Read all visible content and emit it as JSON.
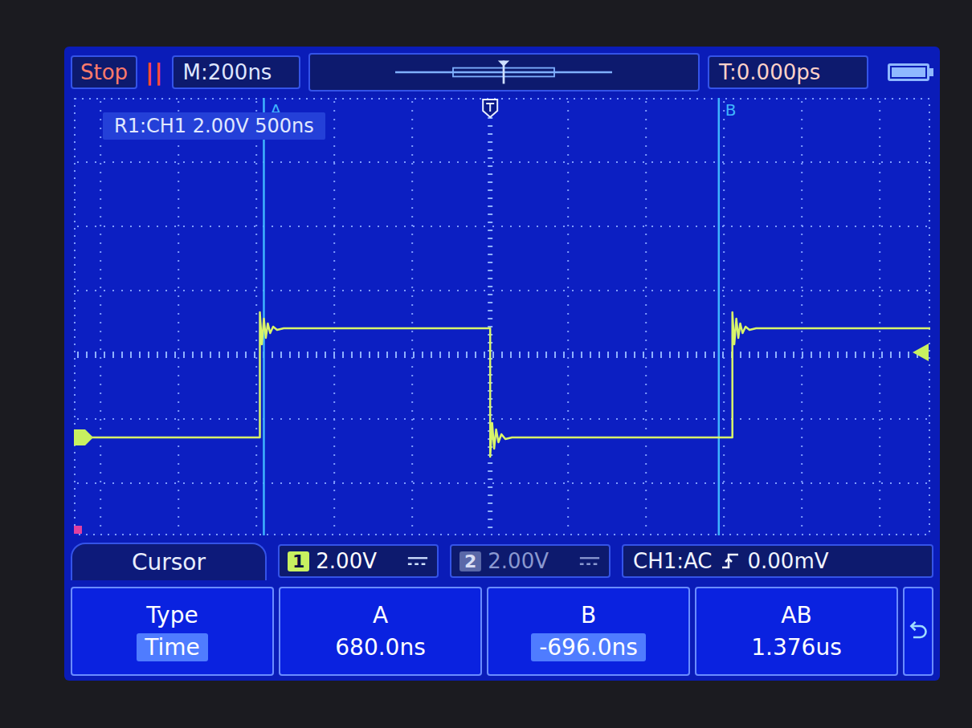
{
  "top_bar": {
    "run_state": "Stop",
    "pause_mark": "||",
    "timebase": "M:200ns",
    "trigger_offset": "T:0.000ps",
    "battery": {
      "level": 1.0
    }
  },
  "plot": {
    "reference_label": "R1:CH1 2.00V 500ns",
    "axis": {
      "time_min_ns": -1260,
      "time_max_ns": 1332
    },
    "waveform": {
      "channel": "CH1",
      "color": "#d8f46a",
      "points": [
        [
          -1260,
          0
        ],
        [
          -697,
          0
        ],
        [
          -697,
          3.9
        ],
        [
          -691,
          2.9
        ],
        [
          -685,
          3.7
        ],
        [
          -679,
          3.1
        ],
        [
          -673,
          3.55
        ],
        [
          -666,
          3.25
        ],
        [
          -657,
          3.45
        ],
        [
          -645,
          3.35
        ],
        [
          -625,
          3.4
        ],
        [
          0,
          3.4
        ],
        [
          0,
          -0.6
        ],
        [
          6,
          0.45
        ],
        [
          12,
          -0.35
        ],
        [
          18,
          0.25
        ],
        [
          25,
          -0.15
        ],
        [
          34,
          0.1
        ],
        [
          46,
          -0.05
        ],
        [
          66,
          0
        ],
        [
          733,
          0
        ],
        [
          733,
          3.9
        ],
        [
          739,
          2.9
        ],
        [
          745,
          3.7
        ],
        [
          751,
          3.1
        ],
        [
          757,
          3.55
        ],
        [
          764,
          3.25
        ],
        [
          773,
          3.45
        ],
        [
          785,
          3.35
        ],
        [
          805,
          3.4
        ],
        [
          1332,
          3.4
        ]
      ]
    },
    "cursors": [
      {
        "label": "A",
        "time_ns": -685
      },
      {
        "label": "B",
        "time_ns": 692
      }
    ],
    "ground_marker_volts": 0,
    "trigger_level_volts": 2.65
  },
  "channel_bar": {
    "tab": "Cursor",
    "channels": [
      {
        "number": "1",
        "scale": "2.00V",
        "enabled": true
      },
      {
        "number": "2",
        "scale": "2.00V",
        "enabled": false
      }
    ],
    "trigger": {
      "source": "CH1:AC",
      "level": "0.00mV"
    }
  },
  "softkeys": [
    {
      "title": "Type",
      "value": "Time",
      "highlighted": true
    },
    {
      "title": "A",
      "value": "680.0ns",
      "highlighted": false
    },
    {
      "title": "B",
      "value": "-696.0ns",
      "highlighted": true
    },
    {
      "title": "AB",
      "value": "1.376us",
      "highlighted": false
    }
  ]
}
